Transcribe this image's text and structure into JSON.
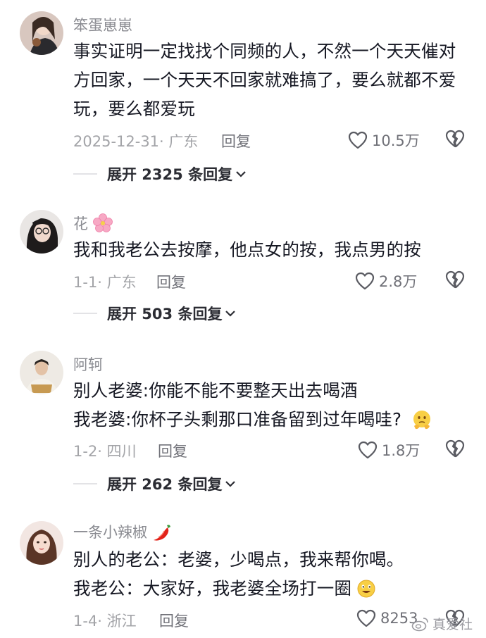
{
  "comments": [
    {
      "username": "笨蛋崽崽",
      "text_lines": [
        "事实证明一定找找个同频的人，不然一个天天催对",
        "方回家，一个天天不回家就难搞了，要么就都不爱",
        "玩，要么都爱玩"
      ],
      "date_location": "2025-12-31· 广东",
      "reply_label": "回复",
      "likes": "10.5万",
      "expand_label": "展开 2325 条回复"
    },
    {
      "username": "花",
      "name_emoji": "cherry-blossom-icon",
      "text_lines": [
        "我和我老公去按摩，他点女的按，我点男的按"
      ],
      "date_location": "1-1· 广东",
      "reply_label": "回复",
      "likes": "2.8万",
      "expand_label": "展开 503 条回复"
    },
    {
      "username": "阿轲",
      "text_lines": [
        "别人老婆:你能不能不要整天出去喝酒",
        "我老婆:你杯子头剩那口准备留到过年喝哇?"
      ],
      "line_emoji": "thinking-emoji-icon",
      "date_location": "1-2· 四川",
      "reply_label": "回复",
      "likes": "1.8万",
      "expand_label": "展开 262 条回复"
    },
    {
      "username": "一条小辣椒",
      "name_emoji": "chili-pepper-icon",
      "text_lines": [
        "别人的老公：老婆，少喝点，我来帮你喝。",
        "我老公：大家好，我老婆全场打一圈"
      ],
      "line_emoji": "grinning-emoji-icon",
      "date_location": "1-4· 浙江",
      "reply_label": "回复",
      "likes": "8253"
    }
  ],
  "watermark": "真爱社",
  "colors": {
    "text": "#161823",
    "muted": "#8a8b91",
    "meta": "#a3a4a8"
  }
}
